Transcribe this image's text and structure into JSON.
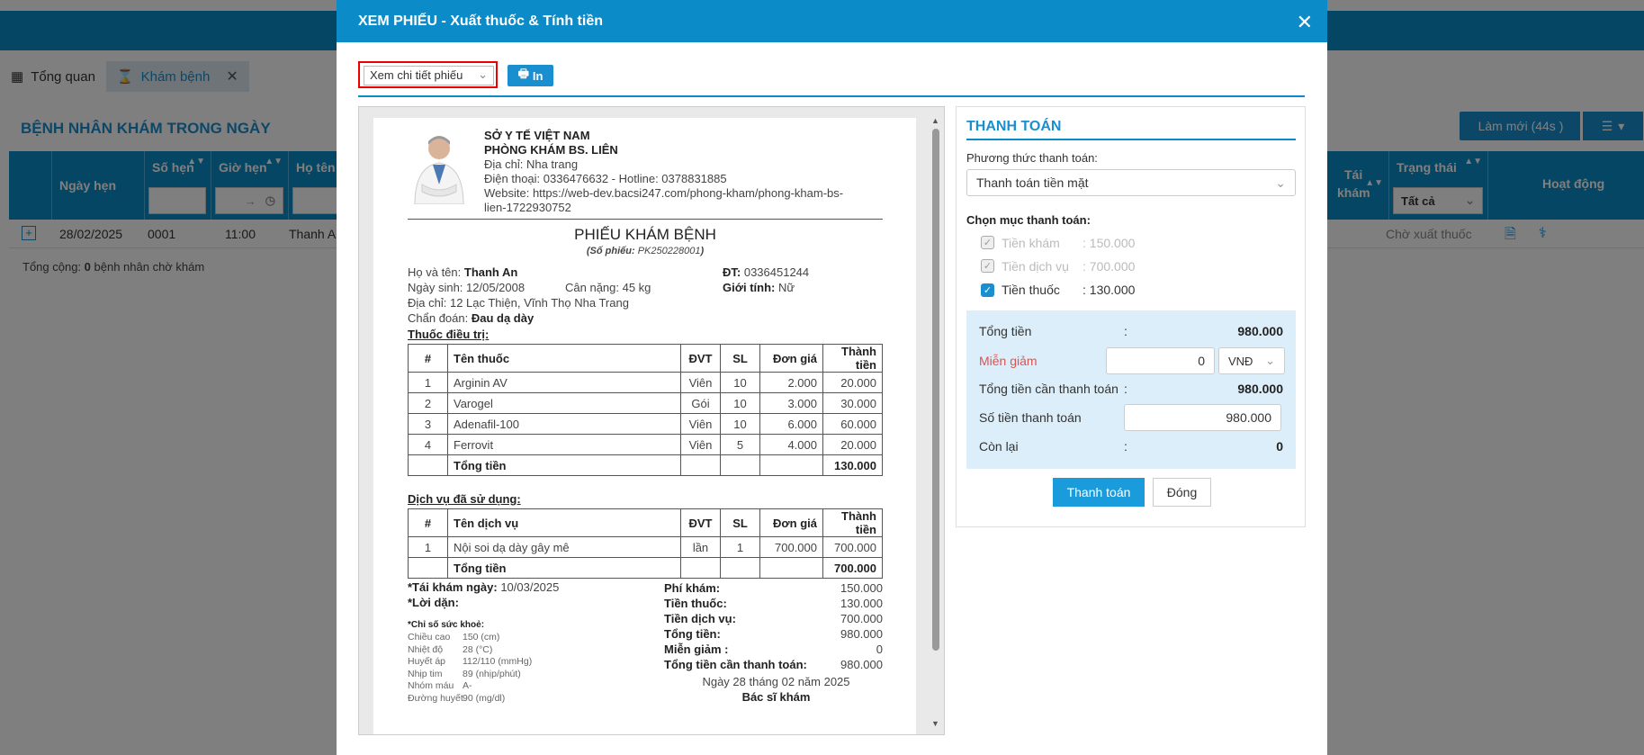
{
  "tabs": [
    {
      "label": "Tổng quan"
    },
    {
      "label": "Khám bệnh"
    }
  ],
  "section": {
    "title": "BỆNH NHÂN KHÁM TRONG NGÀY",
    "refresh_label": "Làm mới (44s )"
  },
  "table": {
    "headers": {
      "date": "Ngày hẹn",
      "num": "Số hẹn",
      "time": "Giờ hẹn",
      "name": "Họ tên",
      "revisit_1": "Tái",
      "revisit_2": "khám",
      "status": "Trạng thái",
      "action": "Hoạt động"
    },
    "status_filter": "Tất cả",
    "time_filter_arrow": "→",
    "row": {
      "date": "28/02/2025",
      "num": "0001",
      "time": "11:00",
      "name": "Thanh An",
      "status": "Chờ xuất thuốc"
    },
    "total_prefix": "Tổng cộng: ",
    "total_count": "0",
    "total_suffix": " bệnh nhân chờ khám"
  },
  "modal": {
    "title": "XEM PHIẾU - Xuất thuốc & Tính tiền",
    "view_select": "Xem chi tiết phiếu",
    "print_label": "In",
    "slip": {
      "org": "SỞ Y TẾ VIỆT NAM",
      "clinic": "PHÒNG KHÁM BS. LIÊN",
      "address": "Địa chỉ: Nha trang",
      "phone": "Điện thoại: 0336476632 - Hotline: 0378831885",
      "website_1": "Website: https://web-dev.bacsi247.com/phong-kham/phong-kham-bs-",
      "website_2": "lien-1722930752",
      "title": "PHIẾU KHÁM BỆNH",
      "code_label": "(Số phiếu: ",
      "code": "PK250228001",
      "code_end": ")",
      "name_label": "Họ và tên: ",
      "name": "Thanh An",
      "phone_label": "ĐT: ",
      "patient_phone": "0336451244",
      "dob": "Ngày sinh: 12/05/2008",
      "weight": "Cân nặng: 45 kg",
      "gender_label": "Giới tính: ",
      "gender": "Nữ",
      "addr": "Địa chỉ: 12 Lạc Thiện, Vĩnh Thọ Nha Trang",
      "diag_label": "Chẩn đoán: ",
      "diag": "Đau dạ dày",
      "meds_title": "Thuốc điều trị:",
      "meds_headers": [
        "#",
        "Tên thuốc",
        "ĐVT",
        "SL",
        "Đơn giá",
        "Thành tiền"
      ],
      "meds": [
        [
          "1",
          "Arginin AV",
          "Viên",
          "10",
          "2.000",
          "20.000"
        ],
        [
          "2",
          "Varogel",
          "Gói",
          "10",
          "3.000",
          "30.000"
        ],
        [
          "3",
          "Adenafil-100",
          "Viên",
          "10",
          "6.000",
          "60.000"
        ],
        [
          "4",
          "Ferrovit",
          "Viên",
          "5",
          "4.000",
          "20.000"
        ]
      ],
      "meds_total_label": "Tổng tiền",
      "meds_total": "130.000",
      "svc_title": "Dịch vụ đã sử dụng:",
      "svc_headers": [
        "#",
        "Tên dịch vụ",
        "ĐVT",
        "SL",
        "Đơn giá",
        "Thành tiền"
      ],
      "svc": [
        [
          "1",
          "Nội soi dạ dày gây mê",
          "lần",
          "1",
          "700.000",
          "700.000"
        ]
      ],
      "svc_total_label": "Tổng tiền",
      "svc_total": "700.000",
      "revisit_label": "*Tái khám ngày: ",
      "revisit": "10/03/2025",
      "advice_label": "*Lời dặn:",
      "health_title": "*Chỉ số sức khoẻ:",
      "health": [
        [
          "Chiều cao",
          "150 (cm)"
        ],
        [
          "Nhiệt độ",
          "28 (°C)"
        ],
        [
          "Huyết áp",
          "112/110 (mmHg)"
        ],
        [
          "Nhịp tim",
          "89 (nhịp/phút)"
        ],
        [
          "Nhóm máu",
          "A-"
        ],
        [
          "Đường huyết",
          "90 (mg/dl)"
        ]
      ],
      "fees": [
        [
          "Phí khám:",
          "150.000"
        ],
        [
          "Tiền thuốc:",
          "130.000"
        ],
        [
          "Tiền dịch vụ:",
          "700.000"
        ],
        [
          "Tổng tiền:",
          "980.000"
        ],
        [
          "Miễn giảm :",
          "0"
        ],
        [
          "Tổng tiền cần thanh toán:",
          "980.000"
        ]
      ],
      "sign_date": "Ngày 28 tháng 02 năm 2025",
      "sign_role": "Bác sĩ khám"
    },
    "payment": {
      "title": "THANH TOÁN",
      "method_label": "Phương thức thanh toán:",
      "method": "Thanh toán tiền mặt",
      "items_label": "Chọn mục thanh toán:",
      "items": [
        {
          "label": "Tiền khám",
          "amount": ": 150.000"
        },
        {
          "label": "Tiền dịch vụ",
          "amount": ": 700.000"
        },
        {
          "label": "Tiền thuốc",
          "amount": ": 130.000"
        }
      ],
      "total_label": "Tổng tiền",
      "total": "980.000",
      "discount_label": "Miễn giảm",
      "discount": "0",
      "currency": "VNĐ",
      "need_label": "Tổng tiền cần thanh toán",
      "need": "980.000",
      "paid_label": "Số tiền thanh toán",
      "paid": "980.000",
      "remain_label": "Còn lại",
      "remain": "0",
      "colon": ":",
      "pay_button": "Thanh toán",
      "close_button": "Đóng"
    }
  }
}
